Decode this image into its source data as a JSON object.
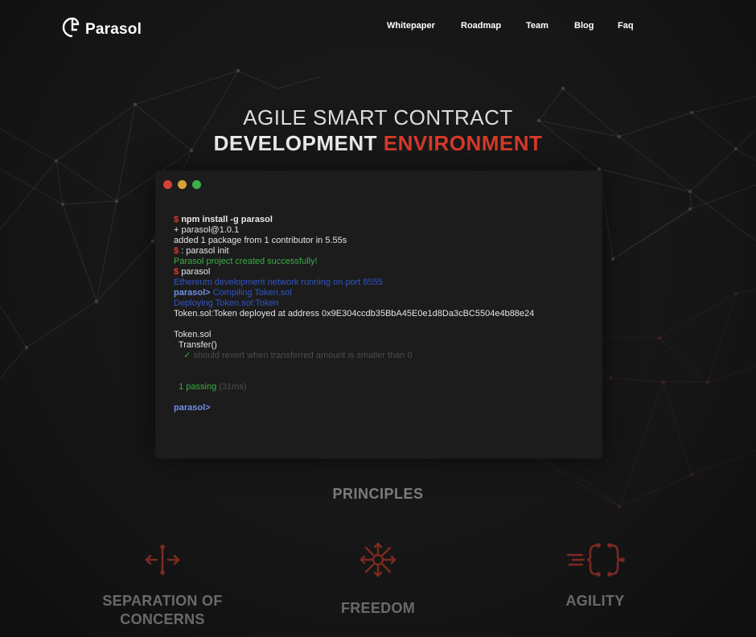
{
  "brand": {
    "name": "Parasol"
  },
  "nav": {
    "items": [
      "Whitepaper",
      "Roadmap",
      "Team",
      "Blog",
      "Faq"
    ]
  },
  "hero": {
    "line1": "AGILE SMART CONTRACT",
    "line2_main": "DEVELOPMENT",
    "line2_accent": "ENVIRONMENT"
  },
  "terminal": {
    "lines": [
      {
        "prompt": "$",
        "text": "npm install -g parasol",
        "style": "cmd-bold"
      },
      {
        "text": "+ parasol@1.0.1",
        "style": "white"
      },
      {
        "text": "added 1 package from 1 contributor in 5.55s",
        "style": "white"
      },
      {
        "prompt": "$",
        "text": ": parasol init",
        "style": "cmd"
      },
      {
        "text": "Parasol project created successfully!",
        "style": "green"
      },
      {
        "prompt": "$",
        "text": "parasol",
        "style": "cmd"
      },
      {
        "text": "Ethereum development network running on port 8555",
        "style": "blue"
      },
      {
        "prompt_blue": "parasol>",
        "text": "Compiling Token.sol",
        "style": "blue"
      },
      {
        "text": "Deploying Token.sol:Token",
        "style": "blue"
      },
      {
        "text": "Token.sol:Token deployed at address 0x9E304ccdb35BbA45E0e1d8Da3cBC5504e4b88e24",
        "style": "white"
      },
      {
        "text": "",
        "style": "gap"
      },
      {
        "text": "Token.sol",
        "style": "white"
      },
      {
        "text": "  Transfer()",
        "style": "white"
      },
      {
        "check": "✓",
        "text": "should revert when transferred amount is smaller than 0",
        "style": "muted"
      },
      {
        "text": "",
        "style": "gap"
      },
      {
        "text": "",
        "style": "gap"
      },
      {
        "passing": "1 passing",
        "time": "(31ms)",
        "style": "passing"
      },
      {
        "text": "",
        "style": "gap"
      },
      {
        "prompt_blue": "parasol>",
        "text": "",
        "style": "blue"
      }
    ]
  },
  "principles": {
    "heading": "PRINCIPLES",
    "items": [
      {
        "icon": "separation-icon",
        "title_l1": "SEPARATION OF",
        "title_l2": "CONCERNS"
      },
      {
        "icon": "freedom-icon",
        "title_l1": "FREEDOM",
        "title_l2": ""
      },
      {
        "icon": "agility-icon",
        "title_l1": "AGILITY",
        "title_l2": ""
      }
    ]
  },
  "colors": {
    "background": "#1a1a1a",
    "accent": "#d93a2b",
    "terminal_bg": "#1c1c1c",
    "green": "#3cad45",
    "blue": "#2f55c9"
  }
}
